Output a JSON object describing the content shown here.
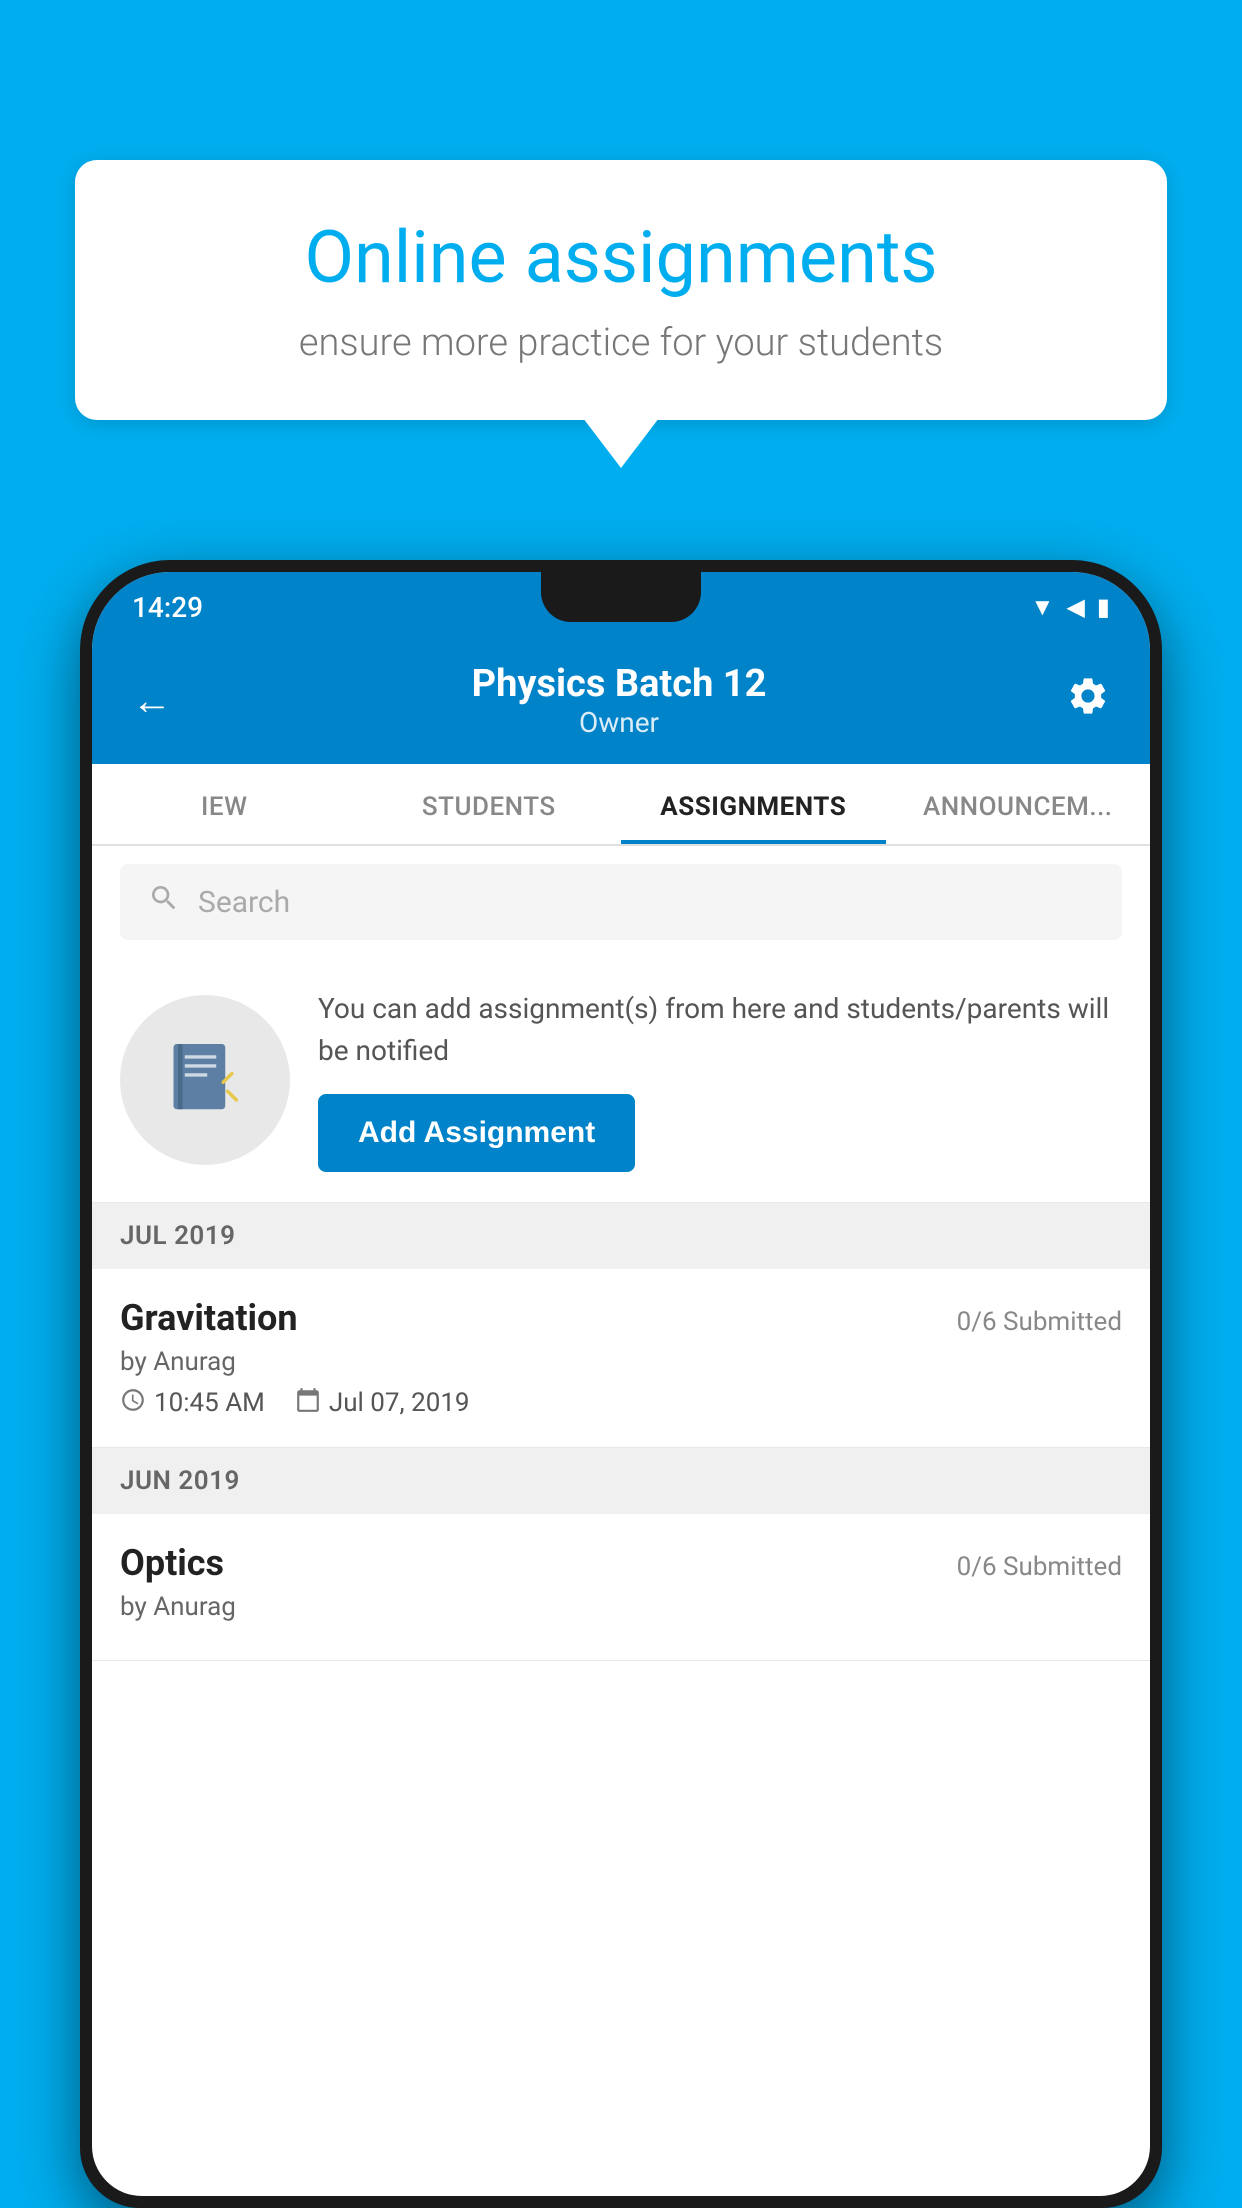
{
  "background_color": "#00AEEF",
  "speech_bubble": {
    "title": "Online assignments",
    "subtitle": "ensure more practice for your students"
  },
  "status_bar": {
    "time": "14:29",
    "icons": [
      "wifi",
      "signal",
      "battery"
    ]
  },
  "header": {
    "title": "Physics Batch 12",
    "subtitle": "Owner",
    "back_label": "←",
    "settings_label": "⚙"
  },
  "tabs": [
    {
      "label": "IEW",
      "active": false
    },
    {
      "label": "STUDENTS",
      "active": false
    },
    {
      "label": "ASSIGNMENTS",
      "active": true
    },
    {
      "label": "ANNOUNCEM...",
      "active": false
    }
  ],
  "search": {
    "placeholder": "Search"
  },
  "promo": {
    "text": "You can add assignment(s) from here and students/parents will be notified",
    "button_label": "Add Assignment"
  },
  "assignment_sections": [
    {
      "month_label": "JUL 2019",
      "assignments": [
        {
          "title": "Gravitation",
          "submitted": "0/6 Submitted",
          "by": "by Anurag",
          "time": "10:45 AM",
          "date": "Jul 07, 2019"
        }
      ]
    },
    {
      "month_label": "JUN 2019",
      "assignments": [
        {
          "title": "Optics",
          "submitted": "0/6 Submitted",
          "by": "by Anurag",
          "time": "",
          "date": ""
        }
      ]
    }
  ]
}
